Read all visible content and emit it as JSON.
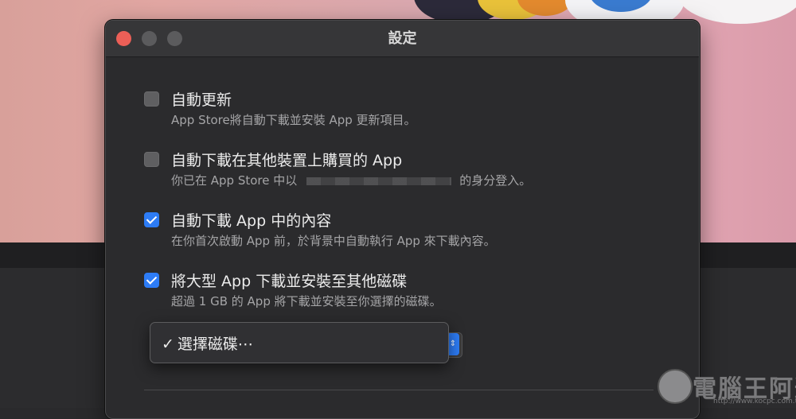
{
  "window": {
    "title": "設定"
  },
  "options": [
    {
      "label": "自動更新",
      "description": "App Store將自動下載並安裝 App 更新項目。",
      "checked": false
    },
    {
      "label": "自動下載在其他裝置上購買的 App",
      "description_prefix": "你已在 App Store 中以",
      "description_suffix": "的身分登入。",
      "checked": false
    },
    {
      "label": "自動下載 App 中的內容",
      "description": "在你首次啟動 App 前，於背景中自動執行 App 來下載內容。",
      "checked": true
    },
    {
      "label": "將大型 App 下載並安裝至其他磁碟",
      "description": "超過 1 GB 的 App 將下載並安裝至你選擇的磁碟。",
      "checked": true
    }
  ],
  "disk_menu": {
    "check": "✓",
    "item": "選擇磁碟⋯"
  },
  "watermark": {
    "text": "電腦王阿達",
    "url": "http://www.kocpc.com.tw"
  },
  "colors": {
    "accent": "#2d7cf6",
    "close": "#ec5f57"
  }
}
